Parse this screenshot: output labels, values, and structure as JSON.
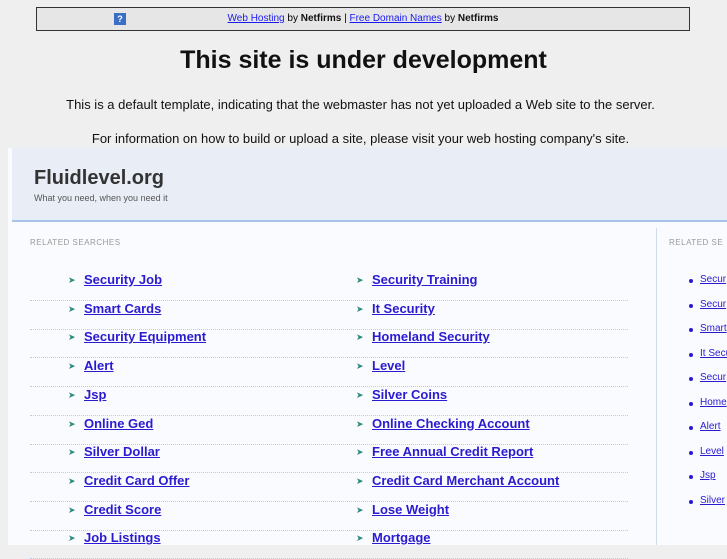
{
  "topbar": {
    "link1": "Web Hosting",
    "by1": " by ",
    "brand1": "Netfirms",
    "sep": " | ",
    "link2": "Free Domain Names",
    "by2": " by ",
    "brand2": "Netfirms",
    "help_icon": "?"
  },
  "title": "This site is under development",
  "line1": "This is a default template, indicating that the webmaster has not yet uploaded a Web site to the server.",
  "line2": "For information on how to build or upload a site, please visit your web hosting company's site.",
  "site": {
    "name": "Fluidlevel.org",
    "tagline": "What you need, when you need it"
  },
  "related_label": "RELATED SEARCHES",
  "side_label": "RELATED SE",
  "left_links": [
    "Security Job",
    "Smart Cards",
    "Security Equipment",
    "Alert",
    "Jsp",
    "Online Ged",
    "Silver Dollar",
    "Credit Card Offer",
    "Credit Score",
    "Job Listings"
  ],
  "right_links": [
    "Security Training",
    "It Security",
    "Homeland Security",
    "Level",
    "Silver Coins",
    "Online Checking Account",
    "Free Annual Credit Report",
    "Credit Card Merchant Account",
    "Lose Weight",
    "Mortgage"
  ],
  "side_links": [
    "Secur",
    "Secur",
    "Smart",
    "It Secu",
    "Secur",
    "Home",
    "Alert",
    "Level",
    "Jsp",
    "Silver"
  ]
}
